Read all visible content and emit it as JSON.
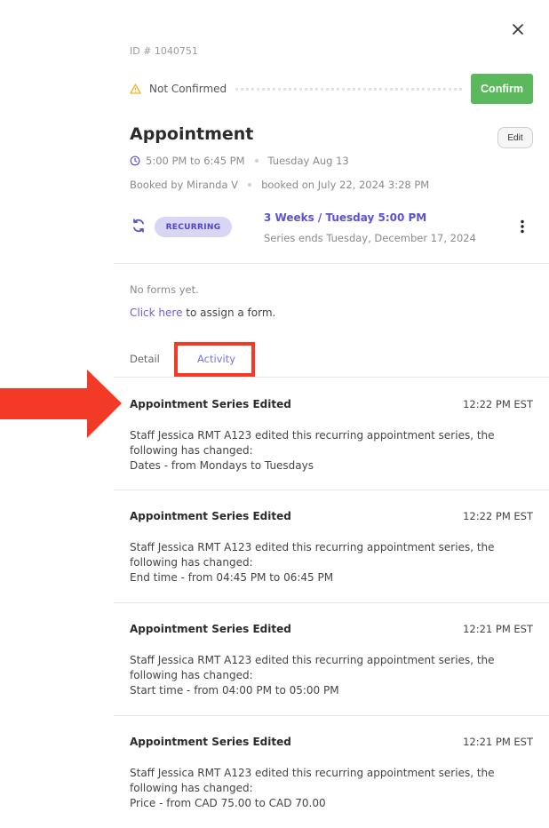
{
  "header": {
    "id_label": "ID # 1040751"
  },
  "status": {
    "text": "Not Confirmed",
    "confirm_label": "Confirm",
    "confirm_color": "#5cb85c"
  },
  "appointment": {
    "title": "Appointment",
    "edit_label": "Edit",
    "time_range": "5:00 PM to 6:45 PM",
    "date": "Tuesday Aug 13",
    "booked_by": "Booked by Miranda V",
    "booked_on": "booked on July 22, 2024 3:28 PM"
  },
  "recurrence": {
    "badge": "RECURRING",
    "pattern": "3 Weeks / Tuesday 5:00 PM",
    "ends": "Series ends Tuesday, December 17, 2024"
  },
  "forms": {
    "empty_text": "No forms yet.",
    "link_text": "Click here",
    "link_suffix": " to assign a form."
  },
  "tabs": [
    {
      "label": "Detail"
    },
    {
      "label": "Activity"
    }
  ],
  "activity": [
    {
      "title": "Appointment Series Edited",
      "time": "12:22 PM EST",
      "line1": "Staff Jessica RMT A123 edited this recurring appointment series, the",
      "line2": "following has changed:",
      "line3": "Dates - from Mondays to Tuesdays"
    },
    {
      "title": "Appointment Series Edited",
      "time": "12:22 PM EST",
      "line1": "Staff Jessica RMT A123 edited this recurring appointment series, the",
      "line2": "following has changed:",
      "line3": "End time - from 04:45 PM to 06:45 PM"
    },
    {
      "title": "Appointment Series Edited",
      "time": "12:21 PM EST",
      "line1": "Staff Jessica RMT A123 edited this recurring appointment series, the",
      "line2": "following has changed:",
      "line3": "Start time - from 04:00 PM to 05:00 PM"
    },
    {
      "title": "Appointment Series Edited",
      "time": "12:21 PM EST",
      "line1": "Staff Jessica RMT A123 edited this recurring appointment series, the",
      "line2": "following has changed:",
      "line3": "Price - from CAD 75.00 to CAD 70.00"
    }
  ],
  "icons": {
    "close": "close-icon",
    "warning": "warning-icon",
    "clock": "clock-icon",
    "recurring": "recurring-icon",
    "more": "more-vertical-icon",
    "annotation": "arrow-right-icon"
  }
}
